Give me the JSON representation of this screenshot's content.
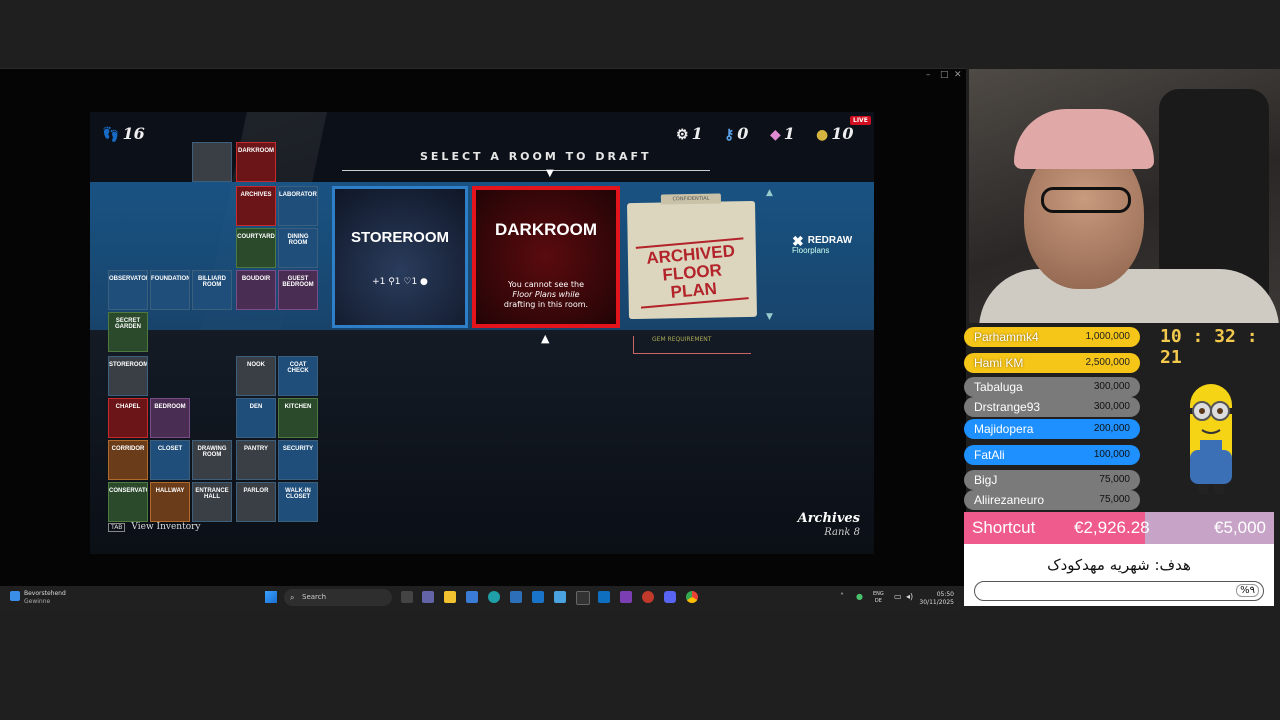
{
  "window": {
    "controls": [
      "–",
      "□",
      "✕"
    ]
  },
  "game": {
    "steps": "16",
    "stats": [
      {
        "icon": "gear-icon",
        "glyph": "⚙",
        "value": "1"
      },
      {
        "icon": "key-icon",
        "glyph": "⚷",
        "value": "0"
      },
      {
        "icon": "gem-icon",
        "glyph": "◆",
        "value": "1"
      },
      {
        "icon": "coin-icon",
        "glyph": "●",
        "value": "10"
      }
    ],
    "live_badge": "LIVE",
    "select_title": "SELECT A ROOM TO DRAFT",
    "cards": {
      "storeroom": {
        "title": "STOREROOM",
        "items": "+1 ⚲1 ♡1 ●"
      },
      "darkroom": {
        "title": "DARKROOM",
        "line1": "You cannot see the",
        "line2": "Floor Plans while",
        "line3": "drafting in this room."
      },
      "archived": {
        "confidential": "CONFIDENTIAL",
        "title": "ARCHIVED FLOOR PLAN"
      }
    },
    "redraw": {
      "title": "REDRAW",
      "sub": "Floorplans"
    },
    "gem_requirement": "GEM REQUIREMENT",
    "location": "Archives",
    "rank": "Rank 8",
    "view_inventory": "View Inventory",
    "view_inventory_key": "TAB",
    "tiles": {
      "t01": "",
      "t02": "DARKROOM",
      "t03": "ARCHIVES",
      "t04": "LABORATORY",
      "t05": "COURTYARD",
      "t06": "DINING ROOM",
      "t07": "OBSERVATORY",
      "t08": "FOUNDATION",
      "t09": "BILLIARD ROOM",
      "t10": "BOUDOIR",
      "t11": "GUEST BEDROOM",
      "t12": "SECRET GARDEN",
      "t13": "STOREROOM",
      "t14": "NOOK",
      "t15": "COAT CHECK",
      "t16": "CHAPEL",
      "t17": "BEDROOM",
      "t18": "DEN",
      "t19": "KITCHEN",
      "t20": "CORRIDOR",
      "t21": "CLOSET",
      "t22": "DRAWING ROOM",
      "t23": "PANTRY",
      "t24": "SECURITY",
      "t25": "CONSERVATORY",
      "t26": "HALLWAY",
      "t27": "ENTRANCE HALL",
      "t28": "PARLOR",
      "t29": "WALK-IN CLOSET"
    }
  },
  "taskbar": {
    "weather_title": "Bevorstehend",
    "weather_sub": "Gewinne",
    "search_placeholder": "Search",
    "lang1": "ENG",
    "lang2": "DE",
    "time": "05:50",
    "date": "30/11/2025"
  },
  "stream": {
    "clock": "10 : 32 : 21",
    "donors": [
      {
        "name": "Parhammk4",
        "amount": "1,000,000",
        "color": "yellow"
      },
      {
        "name": "Hami KM",
        "amount": "2,500,000",
        "color": "yellow"
      },
      {
        "name": "Tabaluga",
        "amount": "300,000",
        "color": "gray"
      },
      {
        "name": "Drstrange93",
        "amount": "300,000",
        "color": "gray"
      },
      {
        "name": "Majidopera",
        "amount": "200,000",
        "color": "blue"
      },
      {
        "name": "FatAli",
        "amount": "100,000",
        "color": "blue"
      },
      {
        "name": "BigJ",
        "amount": "75,000",
        "color": "gray"
      },
      {
        "name": "Aliirezaneuro",
        "amount": "75,000",
        "color": "gray"
      }
    ],
    "shortcut": {
      "label": "Shortcut",
      "current": "€2,926.28",
      "goal": "€5,000",
      "progress": 0.585
    },
    "goal": {
      "text": "هدف: شهریه مهدکودک",
      "percent": "%۹"
    }
  },
  "colors": {
    "accent_red": "#e4141c",
    "accent_blue": "#2f7fc8",
    "donor_yellow": "#f5c518",
    "shortcut_pink": "#ef5b8d",
    "clock_gold": "#f2c94c"
  }
}
